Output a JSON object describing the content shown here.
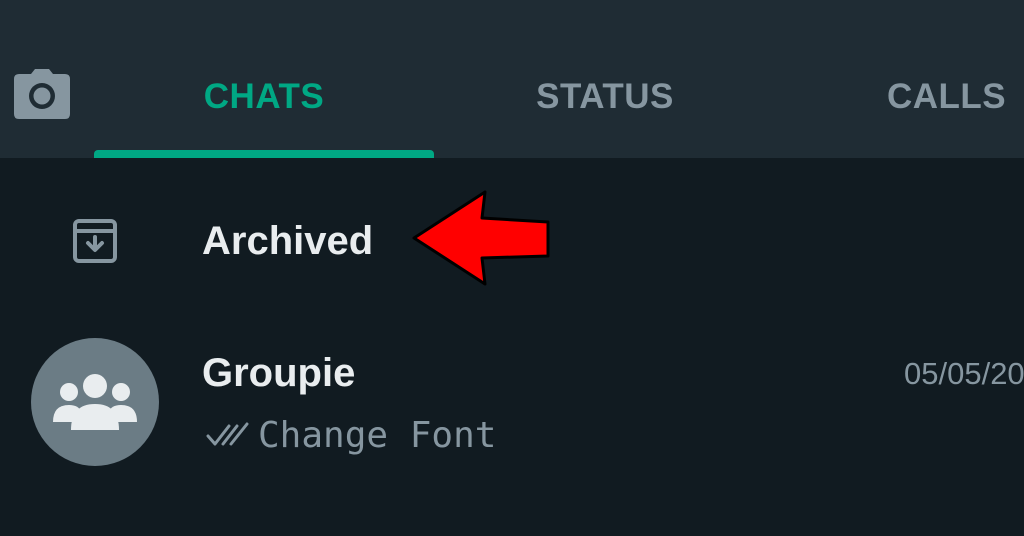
{
  "tabs": {
    "chats": "CHATS",
    "status": "STATUS",
    "calls": "CALLS"
  },
  "active_tab": "chats",
  "icons": {
    "camera": "camera-icon",
    "archive": "archive-box-icon",
    "group_avatar": "group-icon",
    "read_receipt": "double-check-icon",
    "annotation": "red-arrow-icon"
  },
  "archived": {
    "label": "Archived"
  },
  "chats": [
    {
      "name": "Groupie",
      "date": "05/05/20",
      "preview": "Change Font"
    }
  ],
  "colors": {
    "accent": "#00a884",
    "background": "#111b21",
    "header": "#1f2c34",
    "arrow": "#ff0000"
  }
}
